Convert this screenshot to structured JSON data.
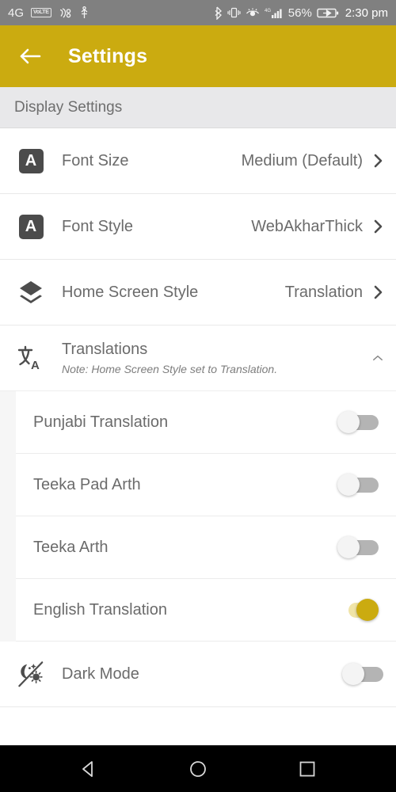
{
  "status_bar": {
    "network": "4G",
    "volte_badge": "VoLTE",
    "icons": [
      "nfc-icon",
      "usb-icon",
      "bluetooth-icon",
      "vibrate-icon",
      "eye-care-icon",
      "signal-4g-icon",
      "battery-charging-icon"
    ],
    "battery_percent": "56%",
    "time": "2:30 pm"
  },
  "app_bar": {
    "back_icon": "arrow-back-icon",
    "title": "Settings",
    "background_color": "#cbab10"
  },
  "section": {
    "title": "Display Settings"
  },
  "rows": [
    {
      "icon": "font-size-icon",
      "icon_letter": "A",
      "label": "Font Size",
      "value": "Medium (Default)",
      "chevron": "chevron-right-icon"
    },
    {
      "icon": "font-style-icon",
      "icon_letter": "A",
      "label": "Font Style",
      "value": "WebAkharThick",
      "chevron": "chevron-right-icon"
    },
    {
      "icon": "layers-icon",
      "label": "Home Screen Style",
      "value": "Translation",
      "chevron": "chevron-right-icon"
    }
  ],
  "translations_group": {
    "icon": "translate-icon",
    "title": "Translations",
    "note": "Note: Home Screen Style set to Translation.",
    "chevron": "chevron-up-icon",
    "expanded": true,
    "items": [
      {
        "label": "Punjabi Translation",
        "enabled": false
      },
      {
        "label": "Teeka Pad Arth",
        "enabled": false
      },
      {
        "label": "Teeka Arth",
        "enabled": false
      },
      {
        "label": "English Translation",
        "enabled": true
      }
    ]
  },
  "dark_mode": {
    "icon": "night-mode-icon",
    "label": "Dark Mode",
    "enabled": false
  },
  "nav_bar": {
    "back": "nav-back-triangle-icon",
    "home": "nav-home-circle-icon",
    "recents": "nav-recents-square-icon"
  },
  "theme": {
    "accent": "#cbab10",
    "toggle_on_track": "#f0e4a8",
    "toggle_off_track": "#b4b4b4",
    "text_primary": "#6b6b6b",
    "status_bar_bg": "#808080"
  }
}
